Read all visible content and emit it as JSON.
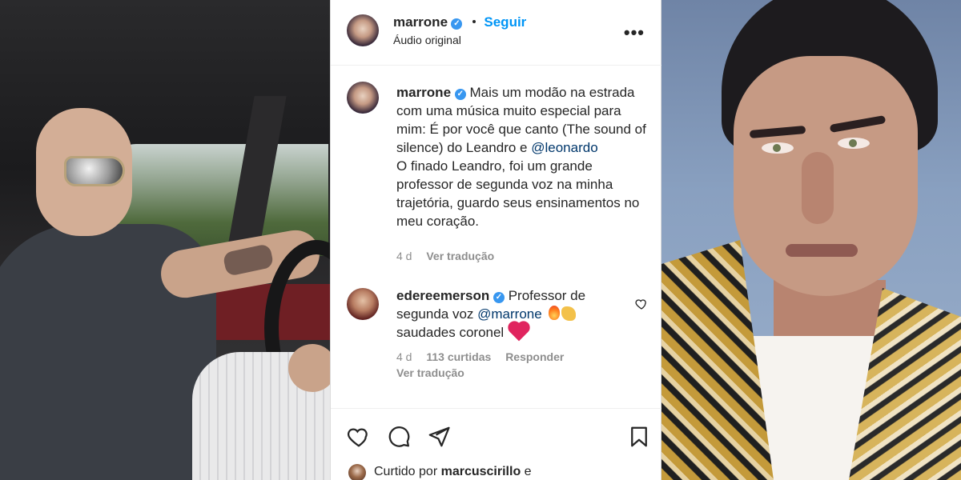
{
  "post": {
    "author": "marrone",
    "follow_label": "Seguir",
    "audio": "Áudio original",
    "more_label": "•••",
    "caption_user": "marrone",
    "caption_text_1": "Mais um modão na estrada com uma música muito especial para mim: É por você que canto (The sound of silence) do Leandro e ",
    "caption_mention": "@leonardo",
    "caption_text_2": "O finado Leandro, foi um grande professor de segunda voz na minha trajetória, guardo seus ensinamentos no meu coração.",
    "caption_time": "4 d",
    "caption_translate": "Ver tradução"
  },
  "comment": {
    "user": "edereemerson",
    "text_1": "Professor de segunda voz ",
    "mention": "@marrone",
    "text_2": "saudades coronel",
    "time": "4 d",
    "likes": "113 curtidas",
    "reply": "Responder",
    "translate": "Ver tradução"
  },
  "footer": {
    "liked_prefix": "Curtido por",
    "liked_user": "marcuscirillo",
    "liked_suffix": "e"
  },
  "icons": {
    "like": "heart-icon",
    "comment": "comment-icon",
    "share": "share-icon",
    "save": "bookmark-icon",
    "verified": "verified-badge-icon",
    "more": "more-options-icon"
  },
  "colors": {
    "accent": "#0095f6",
    "verified": "#3897f0",
    "secondary_text": "#8e8e8e",
    "heart": "#e0245e"
  }
}
